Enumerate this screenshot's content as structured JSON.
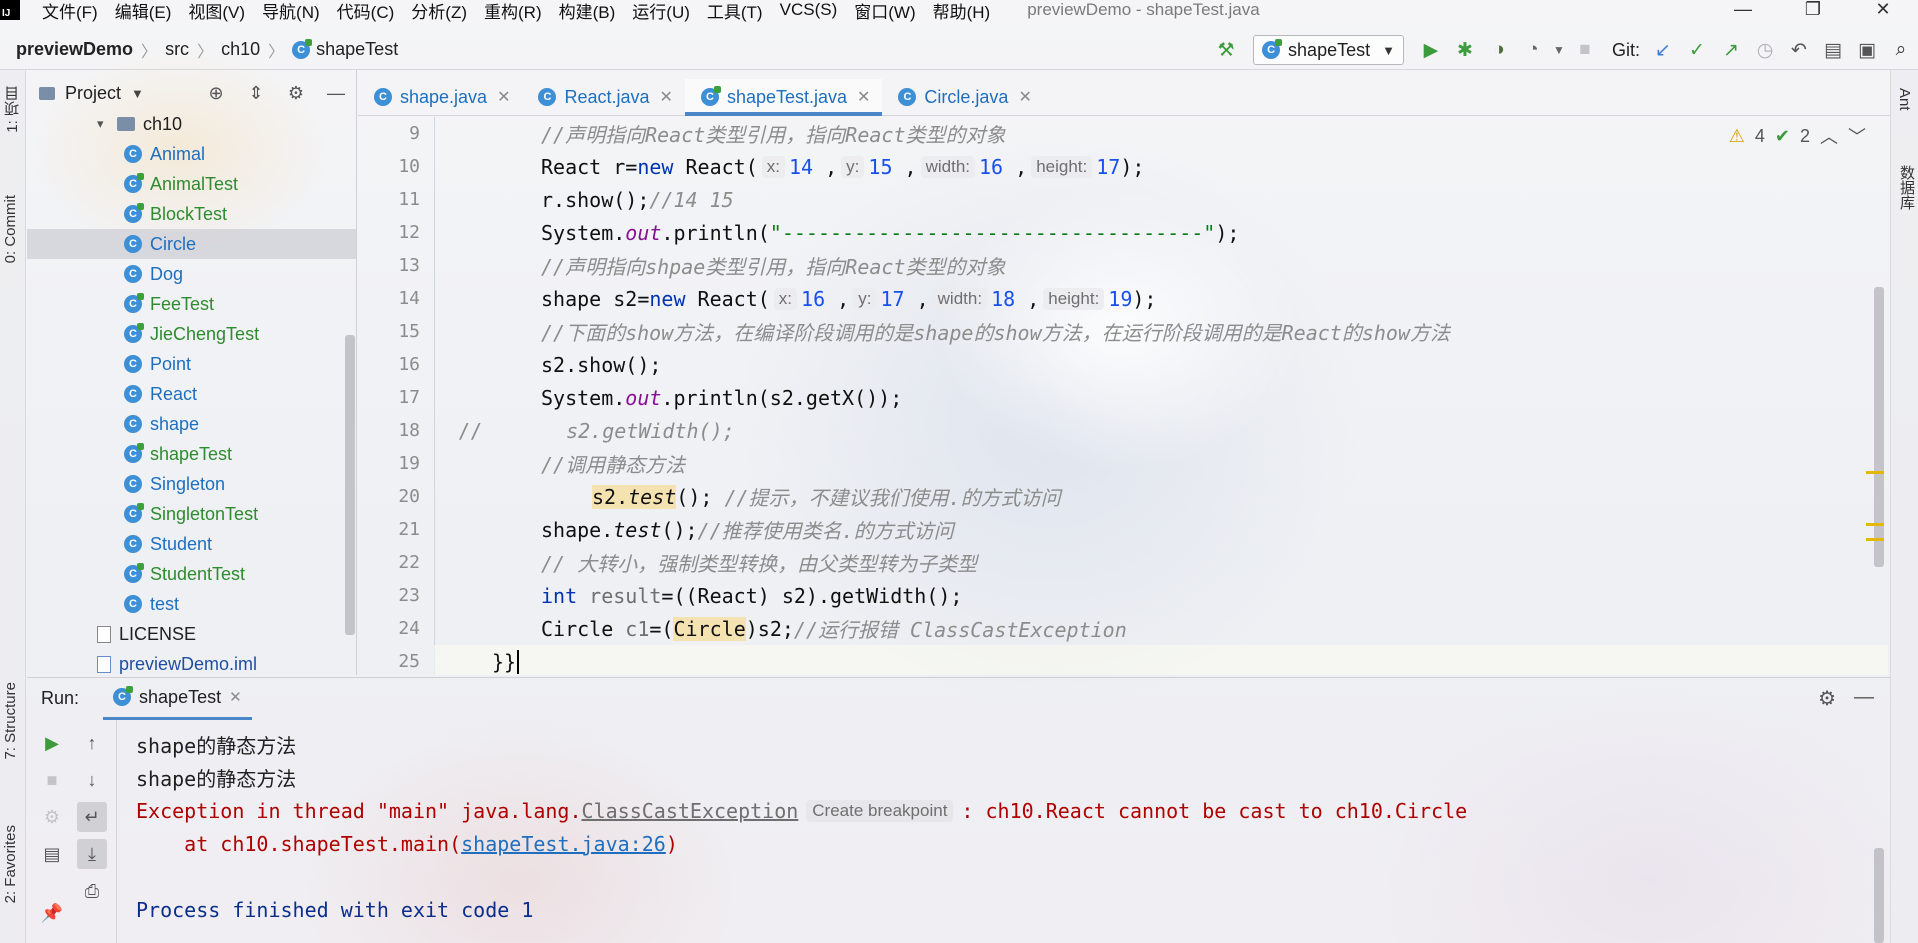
{
  "app": {
    "logo_text": "IJ",
    "menu": [
      "文件(F)",
      "编辑(E)",
      "视图(V)",
      "导航(N)",
      "代码(C)",
      "分析(Z)",
      "重构(R)",
      "构建(B)",
      "运行(U)",
      "工具(T)",
      "VCS(S)",
      "窗口(W)",
      "帮助(H)"
    ],
    "window_title": "previewDemo - shapeTest.java",
    "window_controls": [
      "—",
      "❐",
      "✕"
    ]
  },
  "navbar": {
    "breadcrumb": [
      "previewDemo",
      "src",
      "ch10",
      "shapeTest"
    ],
    "run_config": "shapeTest",
    "git_label": "Git:"
  },
  "left_tabs": [
    "1: 项目",
    "0: Commit",
    "7: Structure",
    "2: Favorites"
  ],
  "right_tabs": [
    "Ant",
    "数据库"
  ],
  "project": {
    "title": "Project",
    "folder": "ch10",
    "items": [
      {
        "name": "Animal",
        "kind": "class"
      },
      {
        "name": "AnimalTest",
        "kind": "test"
      },
      {
        "name": "BlockTest",
        "kind": "test"
      },
      {
        "name": "Circle",
        "kind": "class",
        "selected": true
      },
      {
        "name": "Dog",
        "kind": "class"
      },
      {
        "name": "FeeTest",
        "kind": "test"
      },
      {
        "name": "JieChengTest",
        "kind": "test"
      },
      {
        "name": "Point",
        "kind": "class"
      },
      {
        "name": "React",
        "kind": "class"
      },
      {
        "name": "shape",
        "kind": "class"
      },
      {
        "name": "shapeTest",
        "kind": "test"
      },
      {
        "name": "Singleton",
        "kind": "class"
      },
      {
        "name": "SingletonTest",
        "kind": "test"
      },
      {
        "name": "Student",
        "kind": "class"
      },
      {
        "name": "StudentTest",
        "kind": "test"
      },
      {
        "name": "test",
        "kind": "class"
      }
    ],
    "license": "LICENSE",
    "iml": "previewDemo.iml"
  },
  "editor_tabs": [
    {
      "label": "shape.java",
      "active": false
    },
    {
      "label": "React.java",
      "active": false
    },
    {
      "label": "shapeTest.java",
      "active": true
    },
    {
      "label": "Circle.java",
      "active": false
    }
  ],
  "inspections": {
    "warnings": "4",
    "weak_warnings": "2"
  },
  "code": {
    "line_numbers": [
      "9",
      "10",
      "11",
      "12",
      "13",
      "14",
      "15",
      "16",
      "17",
      "18",
      "19",
      "20",
      "21",
      "22",
      "23",
      "24",
      "25"
    ],
    "l9": "//声明指向React类型引用，指向React类型的对象",
    "l10": {
      "a": "React r=",
      "kw": "new",
      "b": " React(",
      "h1": "x:",
      "v1": "14",
      "h2": "y:",
      "v2": "15",
      "h3": "width:",
      "v3": "16",
      "h4": "height:",
      "v4": "17",
      "end": ");"
    },
    "l11": {
      "code": "r.show();",
      "cmt": "//14 15"
    },
    "l12": {
      "a": "System.",
      "fld": "out",
      "b": ".println(",
      "str": "\"-----------------------------------\"",
      "end": ");"
    },
    "l13": "//声明指向shpae类型引用，指向React类型的对象",
    "l14": {
      "a": "shape s2=",
      "kw": "new",
      "b": " React(",
      "h1": "x:",
      "v1": "16",
      "h2": "y:",
      "v2": "17",
      "h3": "width:",
      "v3": "18",
      "h4": "height:",
      "v4": "19",
      "end": ");"
    },
    "l15": "//下面的show方法，在编译阶段调用的是shape的show方法，在运行阶段调用的是React的show方法",
    "l16": "s2.show();",
    "l17": {
      "a": "System.",
      "fld": "out",
      "b": ".println(s2.getX());"
    },
    "l18": {
      "prefix": "//",
      "body": "s2.getWidth();"
    },
    "l19": "//调用静态方法",
    "l20": {
      "a": "s2.",
      "m": "test",
      "b": "();",
      "cmt": "//提示，不建议我们使用.的方式访问"
    },
    "l21": {
      "a": "shape.",
      "m": "test",
      "b": "();",
      "cmt": "//推荐使用类名.的方式访问"
    },
    "l22": "// 大转小，强制类型转换，由父类型转为子类型",
    "l23": {
      "kw": "int",
      "var": "result",
      "b": "=((React) s2).getWidth();"
    },
    "l24": {
      "a": "Circle ",
      "var": "c1",
      "b": "=(",
      "cast": "Circle",
      "c": ")s2;",
      "cmt": "//运行报错 ClassCastException"
    },
    "l25": "}}"
  },
  "run": {
    "label": "Run:",
    "tab": "shapeTest",
    "out1": "shape的静态方法",
    "out2": "shape的静态方法",
    "exc_prefix": "Exception in thread \"main\" java.lang.",
    "exc_class": "ClassCastException",
    "bp_hint": "Create breakpoint",
    "exc_msg": ": ch10.React cannot be cast to ch10.Circle",
    "at_prefix": "    at ch10.shapeTest.main(",
    "at_link": "shapeTest.java:26",
    "at_suffix": ")",
    "finish": "Process finished with exit code 1"
  }
}
